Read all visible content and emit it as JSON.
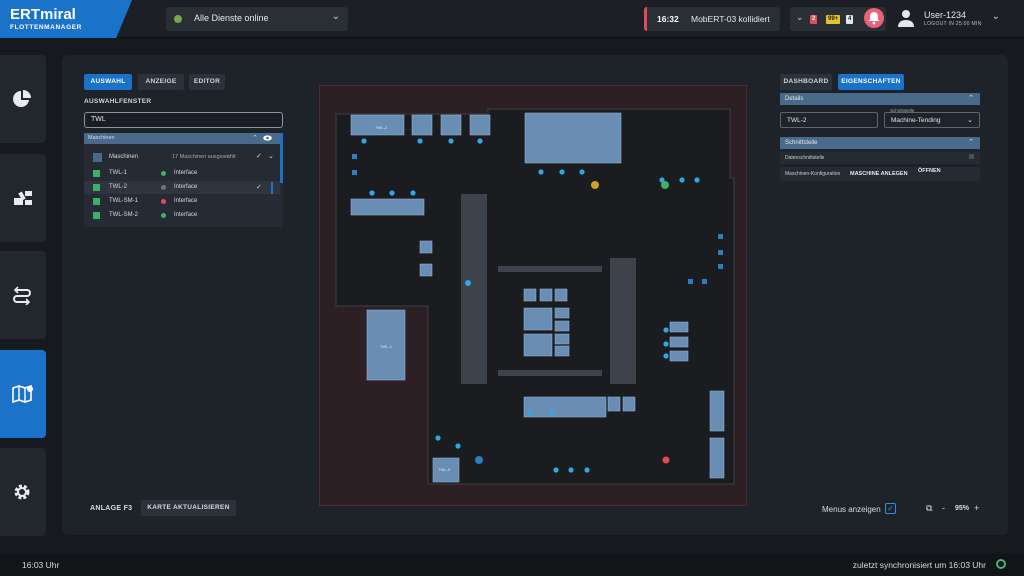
{
  "app": {
    "title": "ERTmiral",
    "subtitle": "FLOTTENMANAGER"
  },
  "services": {
    "label": "Alle Dienste online"
  },
  "alert": {
    "time": "16:32",
    "message": "MobERT-03 kollidiert"
  },
  "badges": [
    {
      "text": "2",
      "color": "#e24b5a"
    },
    {
      "text": "99+",
      "color": "#e6c229"
    },
    {
      "text": "4",
      "color": "#e3e7ec"
    }
  ],
  "user": {
    "name": "User-1234",
    "logout": "LOGOUT IN 25:00 MIN"
  },
  "left_tabs": [
    "AUSWAHL",
    "ANZEIGE",
    "EDITOR"
  ],
  "selection": {
    "title": "AUSWAHLFENSTER",
    "search_value": "TWL",
    "header": "Maschinen",
    "group": {
      "label": "Maschinen",
      "count": "17 Maschinen ausgewählt"
    },
    "rows": [
      {
        "name": "TWL-1",
        "status": "Interface",
        "status_color": "#3fae6a"
      },
      {
        "name": "TWL-2",
        "status": "Interface",
        "status_color": "#6a737d"
      },
      {
        "name": "TWL-SM-1",
        "status": "Interface",
        "status_color": "#e24b5a"
      },
      {
        "name": "TWL-SM-2",
        "status": "Interface",
        "status_color": "#3fae6a"
      }
    ]
  },
  "right_tabs": [
    "DASHBOARD",
    "EIGENSCHAFTEN"
  ],
  "details": {
    "header": "Details",
    "name_value": "TWL-2",
    "type_label": "Schnittstelle",
    "type_value": "Machine-Tending",
    "interface_header": "Schnittstelle",
    "rows": [
      {
        "label": "Datenschnittstelle"
      },
      {
        "label": "Maschinen-Konfiguration",
        "button": "MASCHINE ANLEGEN",
        "button2": "ÖFFNEN"
      }
    ]
  },
  "bottom": {
    "facility": "ANLAGE F3",
    "update_button": "KARTE AKTUALISIEREN",
    "menus_label": "Menus anzeigen",
    "zoom": "95%"
  },
  "map_labels": {
    "large_machine": "TWL-1",
    "top_machine": "TWL-2",
    "bottom_machine": "TWL-3"
  },
  "footer": {
    "time": "16:03 Uhr",
    "sync": "zuletzt synchronisiert um 16:03 Uhr"
  },
  "colors": {
    "accent": "#1a73c9",
    "alert": "#e24b5a",
    "ok": "#3fae6a"
  }
}
